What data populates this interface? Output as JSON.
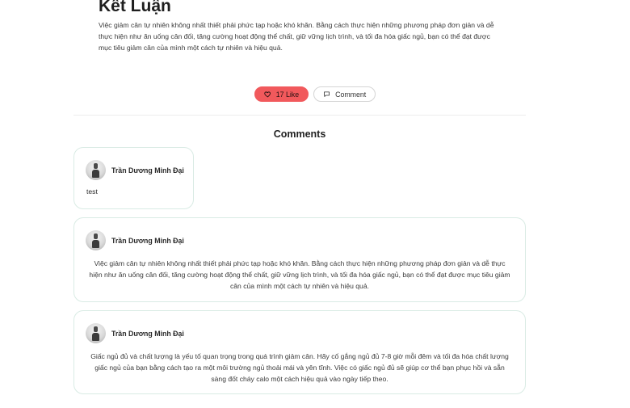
{
  "article": {
    "conclusion_title": "Kết Luận",
    "conclusion_text": "Việc giảm cân tự nhiên không nhất thiết phải phức tạp hoặc khó khăn. Bằng cách thực hiện những phương pháp đơn giản và dễ thực hiện như ăn uống cân đối, tăng cường hoạt động thể chất, giữ vững lịch trình, và tối đa hóa giấc ngủ, bạn có thể đạt được mục tiêu giảm cân của mình một cách tự nhiên và hiệu quả."
  },
  "actions": {
    "like_label": "17 Like",
    "comment_label": "Comment",
    "like_color": "#f1595c"
  },
  "comments_heading": "Comments",
  "comments": [
    {
      "author": "Trần Dương Minh Đại",
      "text": "test"
    },
    {
      "author": "Trần Dương Minh Đại",
      "text": "Việc giảm cân tự nhiên không nhất thiết phải phức tạp hoặc khó khăn. Bằng cách thực hiện những phương pháp đơn giản và dễ thực hiện như ăn uống cân đối, tăng cường hoạt động thể chất, giữ vững lịch trình, và tối đa hóa giấc ngủ, bạn có thể đạt được mục tiêu giảm cân của mình một cách tự nhiên và hiệu quả."
    },
    {
      "author": "Trần Dương Minh Đại",
      "text": "Giấc ngủ đủ và chất lượng là yếu tố quan trọng trong quá trình giảm cân. Hãy cố gắng ngủ đủ 7-8 giờ mỗi đêm và tối đa hóa chất lượng giấc ngủ của bạn bằng cách tạo ra một môi trường ngủ thoải mái và yên tĩnh. Việc có giấc ngủ đủ sẽ giúp cơ thể bạn phục hồi và sẵn sàng đốt cháy calo một cách hiệu quả vào ngày tiếp theo."
    }
  ]
}
